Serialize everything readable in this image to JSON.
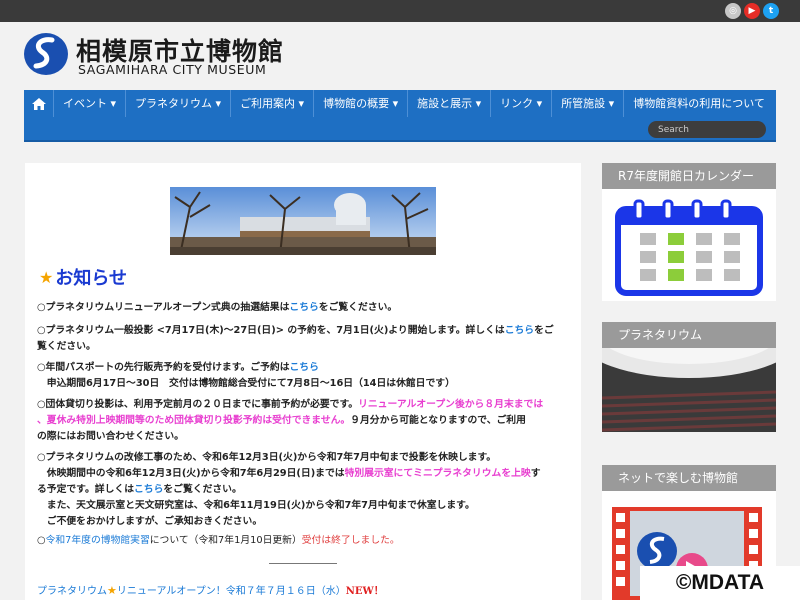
{
  "header": {
    "title_ja": "相模原市立博物館",
    "title_en": "SAGAMIHARA CITY MUSEUM",
    "social": [
      {
        "icon": "instagram-icon",
        "color": "#c7c7c7"
      },
      {
        "icon": "youtube-icon",
        "color": "#e52d27"
      },
      {
        "icon": "twitter-icon",
        "color": "#1da1f2"
      }
    ]
  },
  "nav": {
    "items": [
      {
        "label": "イベント ▾"
      },
      {
        "label": "プラネタリウム ▾"
      },
      {
        "label": "ご利用案内 ▾"
      },
      {
        "label": "博物館の概要 ▾"
      },
      {
        "label": "施設と展示 ▾"
      },
      {
        "label": "リンク ▾"
      },
      {
        "label": "所管施設 ▾"
      },
      {
        "label": "博物館資料の利用について"
      }
    ],
    "search_placeholder": "Search"
  },
  "main": {
    "section_title": "お知らせ",
    "n1": {
      "a": "○プラネタリウムリニューアルオープン式典の抽選結果は",
      "link": "こちら",
      "b": "をご覧ください。"
    },
    "n2": {
      "a": "○プラネタリウム一般投影 <7月17日(木)～27日(日)> の予約を、7月1日(火)より開始します。詳しくは",
      "link": "こちら",
      "b": "をご",
      "c": "覧ください。"
    },
    "n3": {
      "a": "○年間パスポートの先行販売予約を受付けます。ご予約は",
      "link": "こちら",
      "b": "　申込期間6月17日～30日　交付は博物館総合受付にて7月8日～16日（14日は休館日です）"
    },
    "n4": {
      "a": "○団体貸切り投影は、利用予定前月の２０日までに事前予約が必要です。",
      "pink1": "リニューアルオープン後から８月末までは",
      "b": "、夏休み特別上映期間等のため",
      "pink2": "団体貸切り投影予約は受付できません。",
      "c": "９月分から可能となりますので、ご利用",
      "d": "の際にはお問い合わせください。"
    },
    "n5": {
      "a": "○プラネタリウムの改修工事のため、令和6年12月3日(火)から令和7年7月中旬まで投影を休映します。",
      "b": "　休映期間中の令和6年12月3日(火)から令和7年6月29日(日)までは",
      "pink": "特別展示室にてミニプラネタリウムを上映",
      "b2": "す",
      "c": "る予定です。詳しくは",
      "link": "こちら",
      "c2": "をご覧ください。",
      "d": "　また、天文展示室と天文研究室は、令和6年11月19日(火)から令和7年7月中旬まで休室します。",
      "e": "　ご不便をおかけしますが、ご承知おきください。"
    },
    "n6": {
      "a": "○",
      "link": "令和7年度の博物館実習",
      "b": "について（令和7年1月10日更新）",
      "red": "受付は終了しました。"
    },
    "bottom": {
      "a": "プラネタリウム",
      "b": "リニューアルオープン！令和７年７月１６日（水）",
      "new": "NEW！"
    }
  },
  "sidebar": {
    "w1_title": "R7年度開館日カレンダー",
    "w2_title": "プラネタリウム",
    "w3_title": "ネットで楽しむ博物館"
  },
  "watermark": "©MDATA"
}
